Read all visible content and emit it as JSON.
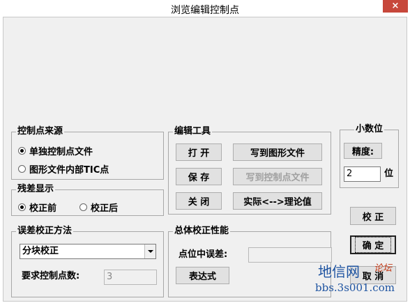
{
  "window": {
    "title": "浏览编辑控制点",
    "close_glyph": "×"
  },
  "control_source": {
    "title": "控制点来源",
    "options": [
      "单独控制点文件",
      "图形文件内部TIC点"
    ],
    "selected": "单独控制点文件"
  },
  "residual": {
    "title": "残差显示",
    "options": [
      "校正前",
      "校正后"
    ],
    "selected": "校正前"
  },
  "edit_tools": {
    "title": "编辑工具",
    "open": "打 开",
    "write_graphic": "写到图形文件",
    "save": "保 存",
    "write_control": "写到控制点文件",
    "close": "关 闭",
    "actual_theory": "实际<-->理论值"
  },
  "decimal": {
    "title": "小数位",
    "precision_button": "精度:",
    "value": "2",
    "unit": "位"
  },
  "correction_method": {
    "title": "误差校正方法",
    "selected": "分块校正",
    "required_label": "要求控制点数:",
    "required_value": "3"
  },
  "overall": {
    "title": "总体校正性能",
    "error_label": "点位中误差:",
    "error_value": "",
    "expression_button": "表达式"
  },
  "actions": {
    "correct": "校 正",
    "ok": "确 定",
    "cancel": "取 消"
  },
  "watermark": {
    "brand": "地信网",
    "script": "论坛",
    "url": "bbs.3s001.com"
  }
}
